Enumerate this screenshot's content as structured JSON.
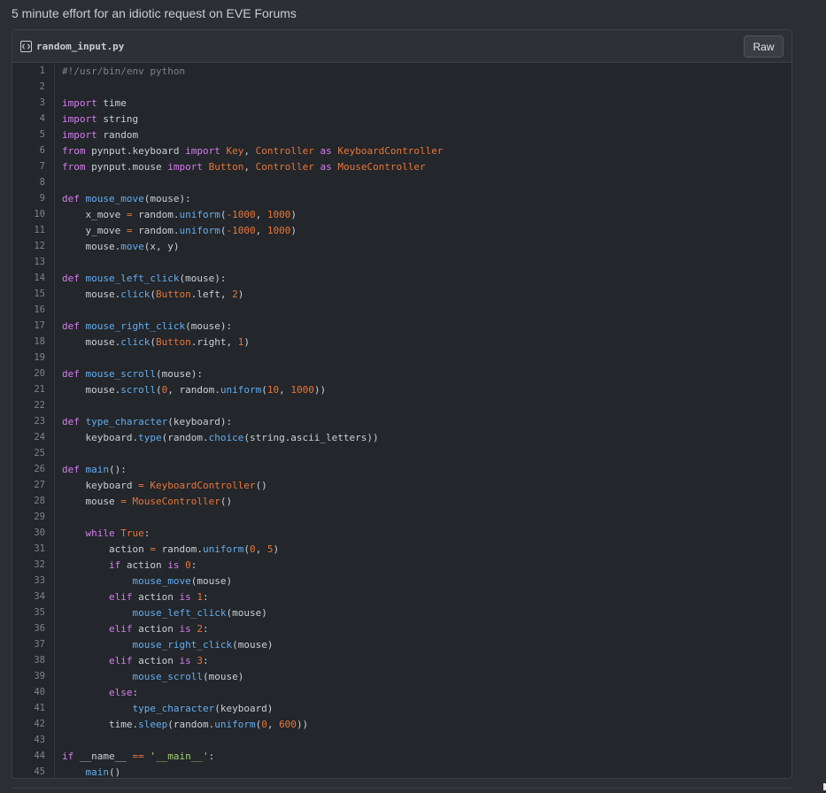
{
  "description": "5 minute effort for an idiotic request on EVE Forums",
  "file": {
    "name": "random_input.py",
    "icon": "code-file-icon",
    "raw_label": "Raw"
  },
  "colors": {
    "background": "#2b2e32",
    "panel": "#23262a",
    "keyword": "#d67df0",
    "function": "#64aef2",
    "class_number": "#e8763a",
    "string": "#a4d17b",
    "comment": "#7d848c"
  },
  "code_lines": [
    [
      {
        "t": "cm",
        "v": "#!/usr/bin/env python"
      }
    ],
    [],
    [
      {
        "t": "kw",
        "v": "import"
      },
      {
        "t": "pl",
        "v": " time"
      }
    ],
    [
      {
        "t": "kw",
        "v": "import"
      },
      {
        "t": "pl",
        "v": " string"
      }
    ],
    [
      {
        "t": "kw",
        "v": "import"
      },
      {
        "t": "pl",
        "v": " random"
      }
    ],
    [
      {
        "t": "kw",
        "v": "from"
      },
      {
        "t": "pl",
        "v": " pynput.keyboard "
      },
      {
        "t": "kw",
        "v": "import"
      },
      {
        "t": "pl",
        "v": " "
      },
      {
        "t": "cl",
        "v": "Key"
      },
      {
        "t": "pl",
        "v": ", "
      },
      {
        "t": "cl",
        "v": "Controller"
      },
      {
        "t": "pl",
        "v": " "
      },
      {
        "t": "kw",
        "v": "as"
      },
      {
        "t": "pl",
        "v": " "
      },
      {
        "t": "cl",
        "v": "KeyboardController"
      }
    ],
    [
      {
        "t": "kw",
        "v": "from"
      },
      {
        "t": "pl",
        "v": " pynput.mouse "
      },
      {
        "t": "kw",
        "v": "import"
      },
      {
        "t": "pl",
        "v": " "
      },
      {
        "t": "cl",
        "v": "Button"
      },
      {
        "t": "pl",
        "v": ", "
      },
      {
        "t": "cl",
        "v": "Controller"
      },
      {
        "t": "pl",
        "v": " "
      },
      {
        "t": "kw",
        "v": "as"
      },
      {
        "t": "pl",
        "v": " "
      },
      {
        "t": "cl",
        "v": "MouseController"
      }
    ],
    [],
    [
      {
        "t": "kw",
        "v": "def"
      },
      {
        "t": "pl",
        "v": " "
      },
      {
        "t": "fn",
        "v": "mouse_move"
      },
      {
        "t": "pl",
        "v": "(mouse):"
      }
    ],
    [
      {
        "t": "pl",
        "v": "    x_move "
      },
      {
        "t": "op",
        "v": "="
      },
      {
        "t": "pl",
        "v": " random."
      },
      {
        "t": "fn",
        "v": "uniform"
      },
      {
        "t": "pl",
        "v": "("
      },
      {
        "t": "nu",
        "v": "-1000"
      },
      {
        "t": "pl",
        "v": ", "
      },
      {
        "t": "nu",
        "v": "1000"
      },
      {
        "t": "pl",
        "v": ")"
      }
    ],
    [
      {
        "t": "pl",
        "v": "    y_move "
      },
      {
        "t": "op",
        "v": "="
      },
      {
        "t": "pl",
        "v": " random."
      },
      {
        "t": "fn",
        "v": "uniform"
      },
      {
        "t": "pl",
        "v": "("
      },
      {
        "t": "nu",
        "v": "-1000"
      },
      {
        "t": "pl",
        "v": ", "
      },
      {
        "t": "nu",
        "v": "1000"
      },
      {
        "t": "pl",
        "v": ")"
      }
    ],
    [
      {
        "t": "pl",
        "v": "    mouse."
      },
      {
        "t": "fn",
        "v": "move"
      },
      {
        "t": "pl",
        "v": "(x, y)"
      }
    ],
    [],
    [
      {
        "t": "kw",
        "v": "def"
      },
      {
        "t": "pl",
        "v": " "
      },
      {
        "t": "fn",
        "v": "mouse_left_click"
      },
      {
        "t": "pl",
        "v": "(mouse):"
      }
    ],
    [
      {
        "t": "pl",
        "v": "    mouse."
      },
      {
        "t": "fn",
        "v": "click"
      },
      {
        "t": "pl",
        "v": "("
      },
      {
        "t": "cl",
        "v": "Button"
      },
      {
        "t": "pl",
        "v": ".left, "
      },
      {
        "t": "nu",
        "v": "2"
      },
      {
        "t": "pl",
        "v": ")"
      }
    ],
    [],
    [
      {
        "t": "kw",
        "v": "def"
      },
      {
        "t": "pl",
        "v": " "
      },
      {
        "t": "fn",
        "v": "mouse_right_click"
      },
      {
        "t": "pl",
        "v": "(mouse):"
      }
    ],
    [
      {
        "t": "pl",
        "v": "    mouse."
      },
      {
        "t": "fn",
        "v": "click"
      },
      {
        "t": "pl",
        "v": "("
      },
      {
        "t": "cl",
        "v": "Button"
      },
      {
        "t": "pl",
        "v": ".right, "
      },
      {
        "t": "nu",
        "v": "1"
      },
      {
        "t": "pl",
        "v": ")"
      }
    ],
    [],
    [
      {
        "t": "kw",
        "v": "def"
      },
      {
        "t": "pl",
        "v": " "
      },
      {
        "t": "fn",
        "v": "mouse_scroll"
      },
      {
        "t": "pl",
        "v": "(mouse):"
      }
    ],
    [
      {
        "t": "pl",
        "v": "    mouse."
      },
      {
        "t": "fn",
        "v": "scroll"
      },
      {
        "t": "pl",
        "v": "("
      },
      {
        "t": "nu",
        "v": "0"
      },
      {
        "t": "pl",
        "v": ", random."
      },
      {
        "t": "fn",
        "v": "uniform"
      },
      {
        "t": "pl",
        "v": "("
      },
      {
        "t": "nu",
        "v": "10"
      },
      {
        "t": "pl",
        "v": ", "
      },
      {
        "t": "nu",
        "v": "1000"
      },
      {
        "t": "pl",
        "v": "))"
      }
    ],
    [],
    [
      {
        "t": "kw",
        "v": "def"
      },
      {
        "t": "pl",
        "v": " "
      },
      {
        "t": "fn",
        "v": "type_character"
      },
      {
        "t": "pl",
        "v": "(keyboard):"
      }
    ],
    [
      {
        "t": "pl",
        "v": "    keyboard."
      },
      {
        "t": "fn",
        "v": "type"
      },
      {
        "t": "pl",
        "v": "(random."
      },
      {
        "t": "fn",
        "v": "choice"
      },
      {
        "t": "pl",
        "v": "(string.ascii_letters))"
      }
    ],
    [],
    [
      {
        "t": "kw",
        "v": "def"
      },
      {
        "t": "pl",
        "v": " "
      },
      {
        "t": "fn",
        "v": "main"
      },
      {
        "t": "pl",
        "v": "():"
      }
    ],
    [
      {
        "t": "pl",
        "v": "    keyboard "
      },
      {
        "t": "op",
        "v": "="
      },
      {
        "t": "pl",
        "v": " "
      },
      {
        "t": "cl",
        "v": "KeyboardController"
      },
      {
        "t": "pl",
        "v": "()"
      }
    ],
    [
      {
        "t": "pl",
        "v": "    mouse "
      },
      {
        "t": "op",
        "v": "="
      },
      {
        "t": "pl",
        "v": " "
      },
      {
        "t": "cl",
        "v": "MouseController"
      },
      {
        "t": "pl",
        "v": "()"
      }
    ],
    [],
    [
      {
        "t": "pl",
        "v": "    "
      },
      {
        "t": "kw",
        "v": "while"
      },
      {
        "t": "pl",
        "v": " "
      },
      {
        "t": "cl",
        "v": "True"
      },
      {
        "t": "pl",
        "v": ":"
      }
    ],
    [
      {
        "t": "pl",
        "v": "        action "
      },
      {
        "t": "op",
        "v": "="
      },
      {
        "t": "pl",
        "v": " random."
      },
      {
        "t": "fn",
        "v": "uniform"
      },
      {
        "t": "pl",
        "v": "("
      },
      {
        "t": "nu",
        "v": "0"
      },
      {
        "t": "pl",
        "v": ", "
      },
      {
        "t": "nu",
        "v": "5"
      },
      {
        "t": "pl",
        "v": ")"
      }
    ],
    [
      {
        "t": "pl",
        "v": "        "
      },
      {
        "t": "kw",
        "v": "if"
      },
      {
        "t": "pl",
        "v": " action "
      },
      {
        "t": "kw",
        "v": "is"
      },
      {
        "t": "pl",
        "v": " "
      },
      {
        "t": "nu",
        "v": "0"
      },
      {
        "t": "pl",
        "v": ":"
      }
    ],
    [
      {
        "t": "pl",
        "v": "            "
      },
      {
        "t": "fn",
        "v": "mouse_move"
      },
      {
        "t": "pl",
        "v": "(mouse)"
      }
    ],
    [
      {
        "t": "pl",
        "v": "        "
      },
      {
        "t": "kw",
        "v": "elif"
      },
      {
        "t": "pl",
        "v": " action "
      },
      {
        "t": "kw",
        "v": "is"
      },
      {
        "t": "pl",
        "v": " "
      },
      {
        "t": "nu",
        "v": "1"
      },
      {
        "t": "pl",
        "v": ":"
      }
    ],
    [
      {
        "t": "pl",
        "v": "            "
      },
      {
        "t": "fn",
        "v": "mouse_left_click"
      },
      {
        "t": "pl",
        "v": "(mouse)"
      }
    ],
    [
      {
        "t": "pl",
        "v": "        "
      },
      {
        "t": "kw",
        "v": "elif"
      },
      {
        "t": "pl",
        "v": " action "
      },
      {
        "t": "kw",
        "v": "is"
      },
      {
        "t": "pl",
        "v": " "
      },
      {
        "t": "nu",
        "v": "2"
      },
      {
        "t": "pl",
        "v": ":"
      }
    ],
    [
      {
        "t": "pl",
        "v": "            "
      },
      {
        "t": "fn",
        "v": "mouse_right_click"
      },
      {
        "t": "pl",
        "v": "(mouse)"
      }
    ],
    [
      {
        "t": "pl",
        "v": "        "
      },
      {
        "t": "kw",
        "v": "elif"
      },
      {
        "t": "pl",
        "v": " action "
      },
      {
        "t": "kw",
        "v": "is"
      },
      {
        "t": "pl",
        "v": " "
      },
      {
        "t": "nu",
        "v": "3"
      },
      {
        "t": "pl",
        "v": ":"
      }
    ],
    [
      {
        "t": "pl",
        "v": "            "
      },
      {
        "t": "fn",
        "v": "mouse_scroll"
      },
      {
        "t": "pl",
        "v": "(mouse)"
      }
    ],
    [
      {
        "t": "pl",
        "v": "        "
      },
      {
        "t": "kw",
        "v": "else"
      },
      {
        "t": "pl",
        "v": ":"
      }
    ],
    [
      {
        "t": "pl",
        "v": "            "
      },
      {
        "t": "fn",
        "v": "type_character"
      },
      {
        "t": "pl",
        "v": "(keyboard)"
      }
    ],
    [
      {
        "t": "pl",
        "v": "        time."
      },
      {
        "t": "fn",
        "v": "sleep"
      },
      {
        "t": "pl",
        "v": "(random."
      },
      {
        "t": "fn",
        "v": "uniform"
      },
      {
        "t": "pl",
        "v": "("
      },
      {
        "t": "nu",
        "v": "0"
      },
      {
        "t": "pl",
        "v": ", "
      },
      {
        "t": "nu",
        "v": "600"
      },
      {
        "t": "pl",
        "v": "))"
      }
    ],
    [],
    [
      {
        "t": "kw",
        "v": "if"
      },
      {
        "t": "pl",
        "v": " __name__ "
      },
      {
        "t": "op",
        "v": "=="
      },
      {
        "t": "pl",
        "v": " "
      },
      {
        "t": "st",
        "v": "'__main__'"
      },
      {
        "t": "pl",
        "v": ":"
      }
    ],
    [
      {
        "t": "pl",
        "v": "    "
      },
      {
        "t": "fn",
        "v": "main"
      },
      {
        "t": "pl",
        "v": "()"
      }
    ]
  ]
}
